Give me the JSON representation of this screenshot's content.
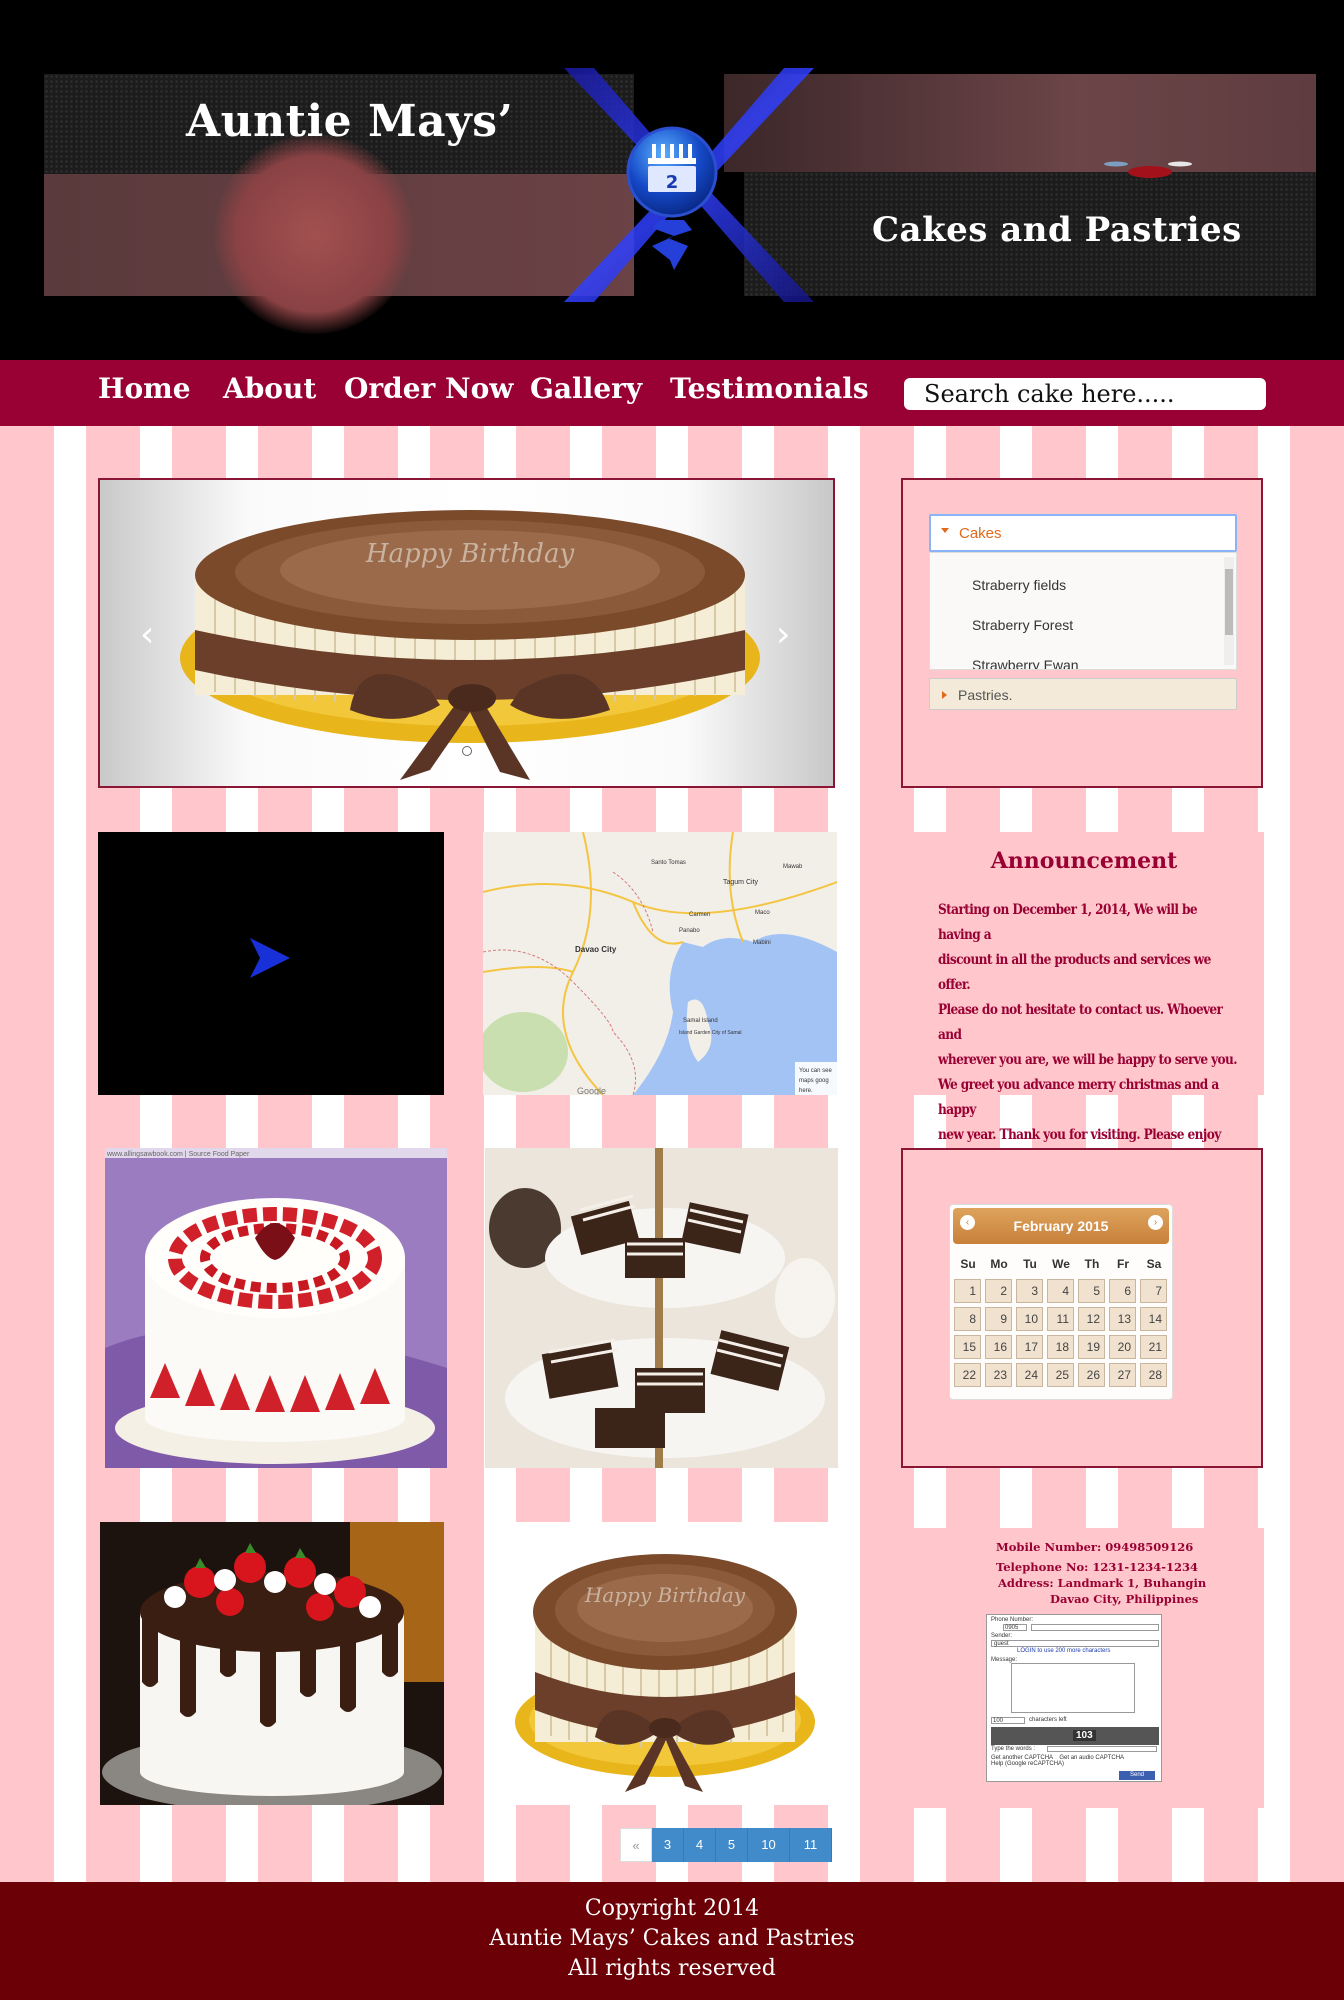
{
  "header": {
    "brand_title": "Auntie Mays’",
    "brand_subtitle": "Cakes and Pastries",
    "calendar_icon_number": "2"
  },
  "nav": {
    "items": [
      {
        "label": "Home"
      },
      {
        "label": "About"
      },
      {
        "label": "Order Now"
      },
      {
        "label": "Gallery"
      },
      {
        "label": "Testimonials"
      }
    ],
    "search_placeholder": "Search cake here....."
  },
  "slider": {
    "image_caption": "Happy Birthday",
    "prev_glyph": "‹",
    "next_glyph": "›"
  },
  "accordion": {
    "section1": "Cakes",
    "items": [
      "Straberry fields",
      "Straberry Forest",
      "Strawberry Ewan"
    ],
    "section2": "Pastries."
  },
  "map": {
    "labels": [
      "Davao City",
      "Tagum City",
      "Panabo",
      "Samal Island",
      "Island Garden City of Samal",
      "Santo Tomas",
      "Carmen",
      "Mawab",
      "Maco",
      "Mabini"
    ],
    "attribution_1": "You can see",
    "attribution_2": "maps goog",
    "attribution_3": "here.",
    "google": "Google"
  },
  "announcement": {
    "title": "Announcement",
    "text": "Starting on December 1, 2014, We will be having a\ndiscount in all the products and services we offer.\nPlease do not hesitate to contact us. Whoever and\nwherever you are, we will be happy to serve you.\nWe greet you advance merry christmas and a happy\n new year. Thank you for visiting. Please enjoy your\n stay."
  },
  "gallery": {
    "photo1_credit": "www.allingsawbook.com | Source Food Paper",
    "photo4_caption": "Happy Birthday"
  },
  "calendar": {
    "month": "February 2015",
    "prev": "‹",
    "next": "›",
    "days_of_week": [
      "Su",
      "Mo",
      "Tu",
      "We",
      "Th",
      "Fr",
      "Sa"
    ],
    "dates": [
      1,
      2,
      3,
      4,
      5,
      6,
      7,
      8,
      9,
      10,
      11,
      12,
      13,
      14,
      15,
      16,
      17,
      18,
      19,
      20,
      21,
      22,
      23,
      24,
      25,
      26,
      27,
      28
    ]
  },
  "contact": {
    "mobile": "Mobile Number: 09498509126",
    "telephone": "Telephone No: 1231-1234-1234",
    "address_1": "Address: Landmark 1, Buhangin",
    "address_2": "Davao City, Philippines",
    "form": {
      "phone_label": "Phone Number:",
      "phone_prefix": "0905",
      "sender_label": "Sender:",
      "sender_value": "guest",
      "login_text": "LOGIN to use 200 more characters",
      "message_label": "Message:",
      "chars_value": "100",
      "chars_label": "characters left",
      "captcha_code": "103",
      "captcha_label": "Type the words :",
      "captcha_links": "Get another CAPTCHA    Get an audio CAPTCHA",
      "captcha_help": "Help (Google reCAPTCHA)",
      "send_label": "Send"
    }
  },
  "pagination": {
    "prev": "«",
    "pages": [
      "3",
      "4",
      "5",
      "10",
      "11"
    ]
  },
  "footer": {
    "line1": "Copyright 2014",
    "line2": "Auntie Mays’ Cakes and Pastries",
    "line3": "All rights reserved"
  }
}
